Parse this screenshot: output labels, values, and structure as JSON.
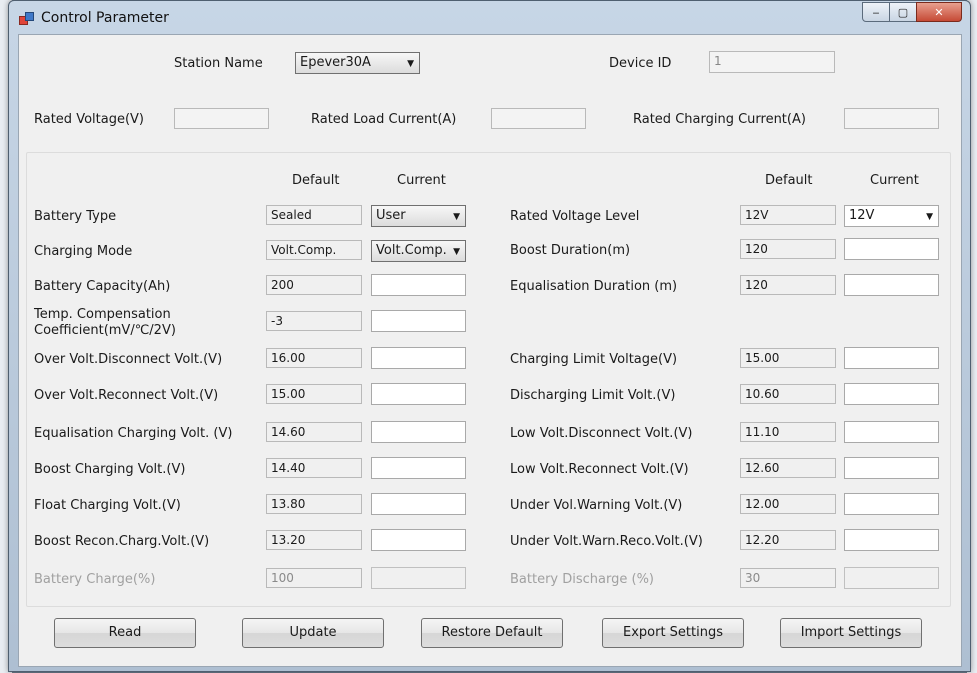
{
  "window": {
    "title": "Control Parameter",
    "minimize_glyph": "‒",
    "maximize_glyph": "▢",
    "close_glyph": "✕"
  },
  "header": {
    "station_name_label": "Station Name",
    "station_name_value": "Epever30A",
    "device_id_label": "Device ID",
    "device_id_value": "1",
    "rated_voltage_label": "Rated Voltage(V)",
    "rated_load_current_label": "Rated Load Current(A)",
    "rated_charging_current_label": "Rated Charging Current(A)"
  },
  "columns": {
    "default": "Default",
    "current": "Current"
  },
  "left_params": [
    {
      "label": "Battery Type",
      "default": "Sealed",
      "current": "User"
    },
    {
      "label": "Charging Mode",
      "default": "Volt.Comp.",
      "current": "Volt.Comp."
    },
    {
      "label": "Battery Capacity(Ah)",
      "default": "200",
      "current": ""
    },
    {
      "label_line1": "Temp. Compensation",
      "label_line2": "Coefficient(mV/℃/2V)",
      "default": "-3",
      "current": ""
    },
    {
      "label": "Over Volt.Disconnect Volt.(V)",
      "default": "16.00",
      "current": ""
    },
    {
      "label": "Over Volt.Reconnect Volt.(V)",
      "default": "15.00",
      "current": ""
    },
    {
      "label": "Equalisation Charging Volt. (V)",
      "default": "14.60",
      "current": ""
    },
    {
      "label": "Boost Charging Volt.(V)",
      "default": "14.40",
      "current": ""
    },
    {
      "label": "Float Charging Volt.(V)",
      "default": "13.80",
      "current": ""
    },
    {
      "label": "Boost Recon.Charg.Volt.(V)",
      "default": "13.20",
      "current": ""
    },
    {
      "label": "Battery Charge(%)",
      "default": "100",
      "current": ""
    }
  ],
  "right_params": [
    {
      "label": "Rated Voltage Level",
      "default": "12V",
      "current": "12V"
    },
    {
      "label": "Boost Duration(m)",
      "default": "120",
      "current": ""
    },
    {
      "label": "Equalisation Duration (m)",
      "default": "120",
      "current": ""
    },
    {
      "label": "Charging Limit Voltage(V)",
      "default": "15.00",
      "current": ""
    },
    {
      "label": "Discharging Limit Volt.(V)",
      "default": "10.60",
      "current": ""
    },
    {
      "label": "Low Volt.Disconnect Volt.(V)",
      "default": "11.10",
      "current": ""
    },
    {
      "label": "Low Volt.Reconnect Volt.(V)",
      "default": "12.60",
      "current": ""
    },
    {
      "label": "Under Vol.Warning Volt.(V)",
      "default": "12.00",
      "current": ""
    },
    {
      "label": "Under Volt.Warn.Reco.Volt.(V)",
      "default": "12.20",
      "current": ""
    },
    {
      "label": "Battery Discharge (%)",
      "default": "30",
      "current": ""
    }
  ],
  "buttons": {
    "read": "Read",
    "update": "Update",
    "restore_default": "Restore Default",
    "export_settings": "Export Settings",
    "import_settings": "Import Settings"
  },
  "icons": {
    "dropdown": "chevron-down-icon",
    "app": "app-window-icon"
  }
}
